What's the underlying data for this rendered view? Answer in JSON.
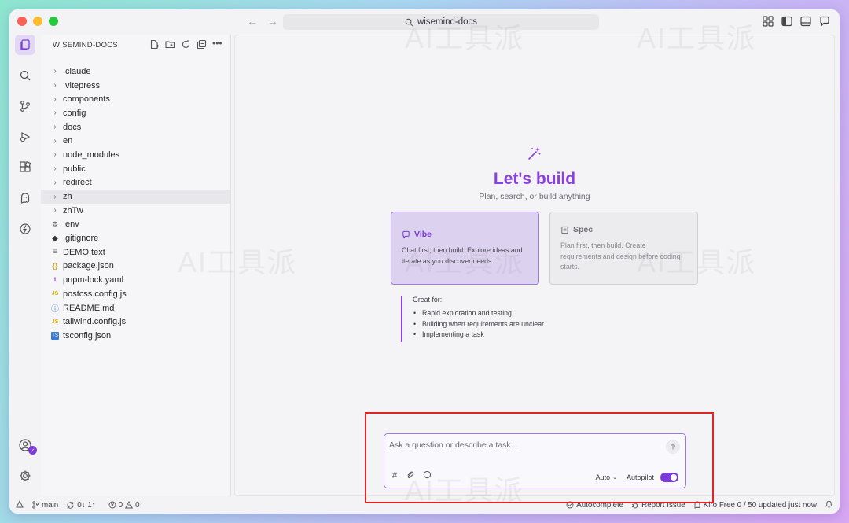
{
  "window": {
    "search_title": "wisemind-docs"
  },
  "explorer": {
    "header": "WISEMIND-DOCS",
    "items": [
      {
        "label": ".claude",
        "kind": "folder"
      },
      {
        "label": ".vitepress",
        "kind": "folder"
      },
      {
        "label": "components",
        "kind": "folder"
      },
      {
        "label": "config",
        "kind": "folder"
      },
      {
        "label": "docs",
        "kind": "folder"
      },
      {
        "label": "en",
        "kind": "folder"
      },
      {
        "label": "node_modules",
        "kind": "folder"
      },
      {
        "label": "public",
        "kind": "folder"
      },
      {
        "label": "redirect",
        "kind": "folder"
      },
      {
        "label": "zh",
        "kind": "folder",
        "selected": true
      },
      {
        "label": "zhTw",
        "kind": "folder"
      },
      {
        "label": ".env",
        "kind": "gear-icon"
      },
      {
        "label": ".gitignore",
        "kind": "git-icon"
      },
      {
        "label": "DEMO.text",
        "kind": "text-icon"
      },
      {
        "label": "package.json",
        "kind": "json-icon"
      },
      {
        "label": "pnpm-lock.yaml",
        "kind": "yaml-icon"
      },
      {
        "label": "postcss.config.js",
        "kind": "js-icon"
      },
      {
        "label": "README.md",
        "kind": "info-icon"
      },
      {
        "label": "tailwind.config.js",
        "kind": "js-icon"
      },
      {
        "label": "tsconfig.json",
        "kind": "ts-icon"
      }
    ]
  },
  "hero": {
    "title": "Let's build",
    "subtitle": "Plan, search, or build anything"
  },
  "cards": {
    "vibe": {
      "title": "Vibe",
      "description": "Chat first, then build. Explore ideas and iterate as you discover needs."
    },
    "spec": {
      "title": "Spec",
      "description": "Plan first, then build. Create requirements and design before coding starts."
    }
  },
  "great_for": {
    "title": "Great for:",
    "items": [
      "Rapid exploration and testing",
      "Building when requirements are unclear",
      "Implementing a task"
    ]
  },
  "chat": {
    "placeholder": "Ask a question or describe a task...",
    "model_label": "Auto",
    "autopilot_label": "Autopilot",
    "autopilot_on": true
  },
  "statusbar": {
    "branch": "main",
    "sync": "0↓ 1↑",
    "errors": "0",
    "warnings": "0",
    "autocomplete": "Autocomplete",
    "report_issue": "Report Issue",
    "plan_status": "Kiro Free 0 / 50 updated just now"
  },
  "watermark": "AI工具派",
  "colors": {
    "accent": "#8a3fe0",
    "vibe_bg": "#dcd2ef",
    "highlight_border": "#e32222"
  }
}
